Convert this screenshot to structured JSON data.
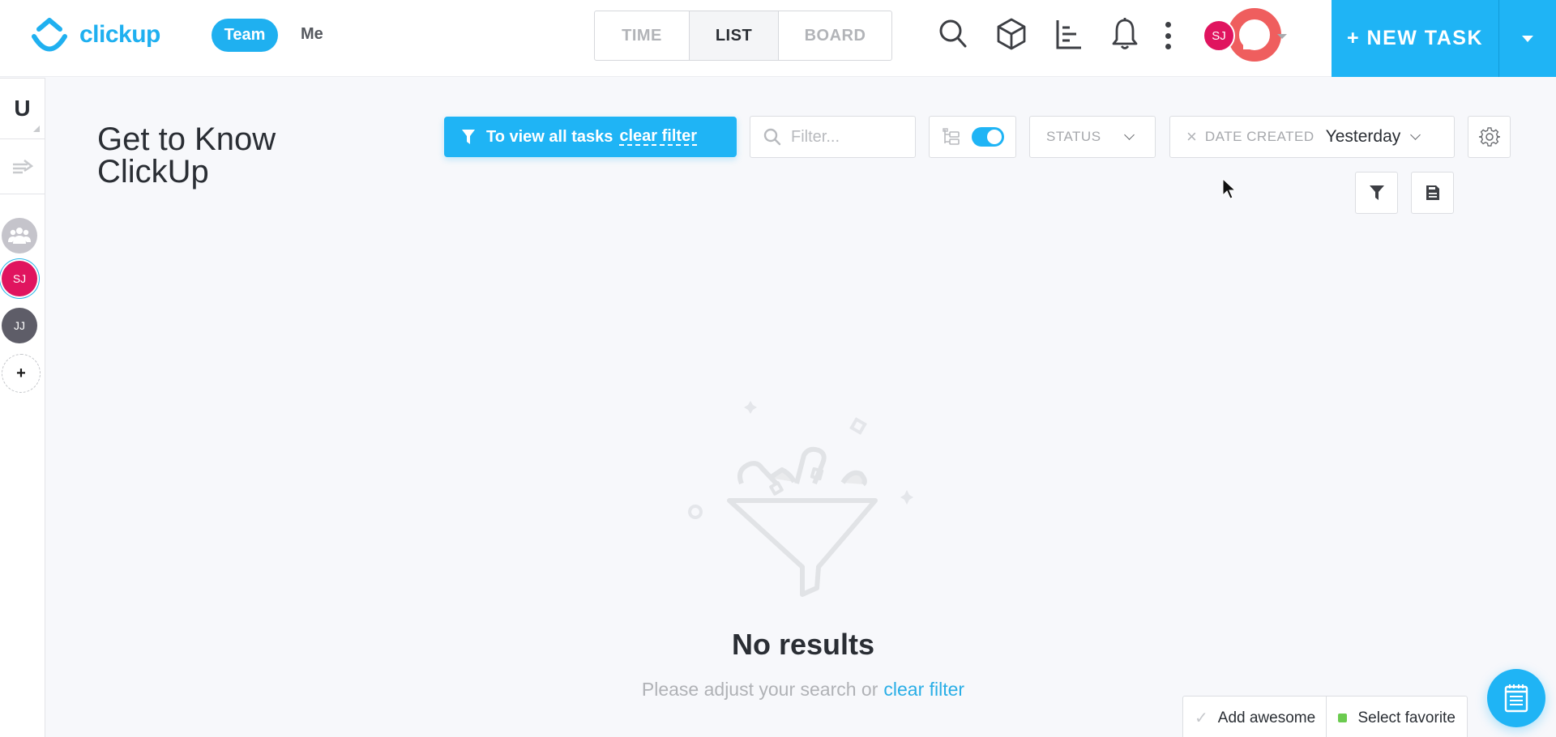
{
  "brand": {
    "name": "clickup",
    "color": "#1fb0f0"
  },
  "header": {
    "scope_tabs": [
      {
        "label": "Team",
        "active": true
      },
      {
        "label": "Me",
        "active": false
      }
    ],
    "view_tabs": [
      {
        "label": "TIME",
        "active": false
      },
      {
        "label": "LIST",
        "active": true
      },
      {
        "label": "BOARD",
        "active": false
      }
    ],
    "icons": [
      "search-icon",
      "box-icon",
      "dashboard-icon",
      "bell-icon",
      "more-vertical-icon"
    ],
    "user_initials": "SJ",
    "new_task_label": "+ NEW TASK"
  },
  "sidebar": {
    "space_letter": "U",
    "members": [
      {
        "type": "group",
        "initials": ""
      },
      {
        "type": "user",
        "initials": "SJ",
        "color": "#e0145f",
        "selected": true
      },
      {
        "type": "user",
        "initials": "JJ",
        "color": "#5e5d68",
        "selected": false
      }
    ],
    "add_member_label": "+"
  },
  "page": {
    "title": "Get to Know ClickUp"
  },
  "toolbar": {
    "banner_text": "To view all tasks",
    "banner_link": "clear filter",
    "search_placeholder": "Filter...",
    "search_value": "",
    "subtasks_toggle_on": true,
    "status_label": "STATUS",
    "date_filter_label": "DATE CREATED",
    "date_filter_value": "Yesterday",
    "clear_x": "×"
  },
  "empty_state": {
    "title": "No results",
    "message": "Please adjust your search or",
    "link": "clear filter"
  },
  "tray": {
    "items": [
      {
        "label": "Add awesome",
        "icon": "check-icon"
      },
      {
        "label": "Select favorite",
        "icon": "status-dot",
        "color": "#6bcb4f"
      }
    ]
  },
  "colors": {
    "accent": "#1fb4f5",
    "link": "#29aee6"
  }
}
